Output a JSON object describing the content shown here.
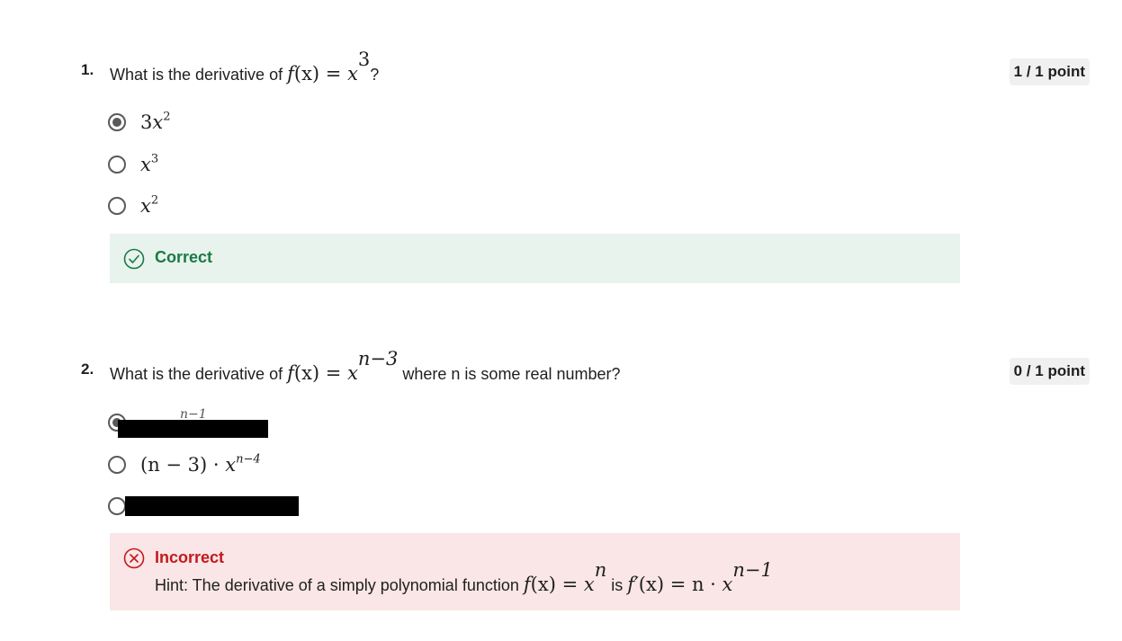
{
  "questions": [
    {
      "number": "1.",
      "prompt_prefix": "What is the derivative of ",
      "prompt_math_fx": "f",
      "prompt_math_x": "(x)",
      "prompt_eq": " = ",
      "prompt_math_base": "x",
      "prompt_math_exp": "3",
      "prompt_suffix": "?",
      "points": "1 / 1 point",
      "options": [
        {
          "coef": "3",
          "base": "x",
          "exp": "2",
          "selected": true
        },
        {
          "coef": "",
          "base": "x",
          "exp": "3",
          "selected": false
        },
        {
          "coef": "",
          "base": "x",
          "exp": "2",
          "selected": false
        }
      ],
      "feedback": {
        "status": "correct",
        "title": "Correct"
      }
    },
    {
      "number": "2.",
      "prompt_prefix": "What is the derivative of ",
      "prompt_math_fx": "f",
      "prompt_math_x": "(x)",
      "prompt_eq": " = ",
      "prompt_math_base": "x",
      "prompt_math_exp": "n−3",
      "prompt_suffix": " where n is some real number?",
      "points": "0 / 1 point",
      "options": [
        {
          "visible_fragment": "n−1",
          "selected": true,
          "redacted": true
        },
        {
          "coef": "(n − 3) · ",
          "base": "x",
          "exp": "n−4",
          "selected": false
        },
        {
          "selected": false,
          "redacted": true
        }
      ],
      "feedback": {
        "status": "incorrect",
        "title": "Incorrect",
        "hint_prefix": "Hint: The derivative of a simply polynomial function ",
        "hint_fx": "f",
        "hint_x": "(x)",
        "hint_eq": " = ",
        "hint_base": "x",
        "hint_exp": "n",
        "hint_mid": " is ",
        "hint_fprime": "f′",
        "hint_x2": "(x)",
        "hint_eq2": " = n · ",
        "hint_base2": "x",
        "hint_exp2": "n−1"
      }
    }
  ],
  "colors": {
    "correct_bg": "#e8f3ee",
    "correct_text": "#1a7a45",
    "incorrect_bg": "#fae6e6",
    "incorrect_text": "#c3181f",
    "points_bg": "#f0f0f0",
    "radio": "#5a5a5a"
  },
  "icons": {
    "correct": "check-circle-icon",
    "incorrect": "x-circle-icon"
  }
}
